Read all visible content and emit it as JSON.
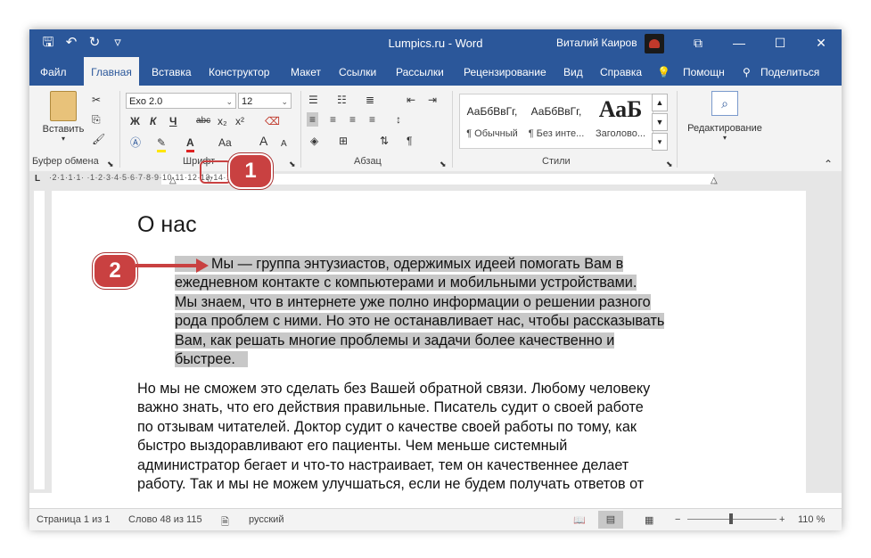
{
  "window": {
    "title": "Lumpics.ru - Word",
    "user": "Виталий Каиров",
    "qat": {
      "save": "🖫",
      "undo": "↶",
      "redo": "↻",
      "more": "▿"
    },
    "controls": {
      "restore": "⧉",
      "minimize": "—",
      "maximize": "☐",
      "close": "✕"
    }
  },
  "tabs": [
    {
      "label": "Файл"
    },
    {
      "label": "Главная"
    },
    {
      "label": "Вставка"
    },
    {
      "label": "Конструктор"
    },
    {
      "label": "Макет"
    },
    {
      "label": "Ссылки"
    },
    {
      "label": "Рассылки"
    },
    {
      "label": "Рецензирование"
    },
    {
      "label": "Вид"
    },
    {
      "label": "Справка"
    },
    {
      "label": "Помощн"
    },
    {
      "label": "Поделиться"
    }
  ],
  "ribbon": {
    "clipboard": {
      "paste_label": "Вставить",
      "group_label": "Буфер обмена"
    },
    "font": {
      "name": "Exo 2.0",
      "size": "12",
      "group_label": "Шрифт",
      "bold": "Ж",
      "italic": "К",
      "underline": "Ч",
      "strike": "abc",
      "sub": "x₂",
      "sup": "x²",
      "grow": "A",
      "shrink": "A",
      "case": "Aa",
      "color": "A"
    },
    "paragraph": {
      "group_label": "Абзац"
    },
    "styles": {
      "group_label": "Стили",
      "items": [
        {
          "sample": "АаБбВвГг,",
          "name": "¶ Обычный"
        },
        {
          "sample": "АаБбВвГг,",
          "name": "¶ Без инте..."
        },
        {
          "sample": "АаБ",
          "name": "Заголово..."
        }
      ]
    },
    "editing": {
      "label": "Редактирование"
    }
  },
  "ruler": {
    "numbers": "·2·1·1·1·   ·1·2·3·4·5·6·7·8·9·10·11·12·13·14·15·16·17·"
  },
  "document": {
    "heading": "О нас",
    "para1_lines": [
      "Мы — группа энтузиастов, одержимых идеей помогать Вам в",
      "ежедневном контакте с компьютерами и мобильными устройствами.",
      "Мы знаем, что в интернете уже полно информации о решении разного",
      "рода проблем с ними. Но это не останавливает нас, чтобы рассказывать",
      "Вам, как решать многие проблемы и задачи более качественно и",
      "быстрее."
    ],
    "para2_lines": [
      "Но мы не сможем это сделать без Вашей обратной связи. Любому человеку",
      "важно знать, что его действия правильные. Писатель судит о своей работе",
      "по отзывам читателей. Доктор судит о качестве своей работы по тому, как",
      "быстро выздоравливают его пациенты. Чем меньше системный",
      "администратор бегает и что-то настраивает, тем он качественнее делает",
      "работу. Так и мы не можем улучшаться, если не будем получать ответов от"
    ]
  },
  "status": {
    "page": "Страница 1 из 1",
    "words": "Слово 48 из 115",
    "language": "русский",
    "zoom": "110 %"
  },
  "callouts": {
    "one": "1",
    "two": "2"
  },
  "colors": {
    "accent": "#2b579a",
    "callout": "#c94141",
    "highlight": "#c8c8c8"
  }
}
